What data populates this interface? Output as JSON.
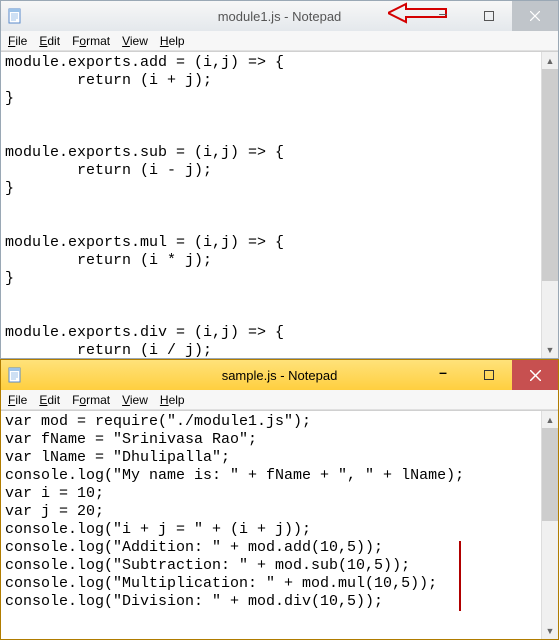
{
  "windows": [
    {
      "title": "module1.js - Notepad",
      "active": false,
      "menu": [
        "File",
        "Edit",
        "Format",
        "View",
        "Help"
      ],
      "menu_ul": [
        "F",
        "E",
        "o",
        "V",
        "H"
      ],
      "content": "module.exports.add = (i,j) => {\n        return (i + j);\n}\n\n\nmodule.exports.sub = (i,j) => {\n        return (i - j);\n}\n\n\nmodule.exports.mul = (i,j) => {\n        return (i * j);\n}\n\n\nmodule.exports.div = (i,j) => {\n        return (i / j);\n}",
      "scrollbar_thumb": {
        "top": 0,
        "height_pct": 78
      }
    },
    {
      "title": "sample.js - Notepad",
      "active": true,
      "menu": [
        "File",
        "Edit",
        "Format",
        "View",
        "Help"
      ],
      "menu_ul": [
        "F",
        "E",
        "o",
        "V",
        "H"
      ],
      "content": "var mod = require(\"./module1.js\");\nvar fName = \"Srinivasa Rao\";\nvar lName = \"Dhulipalla\";\nconsole.log(\"My name is: \" + fName + \", \" + lName);\nvar i = 10;\nvar j = 20;\nconsole.log(\"i + j = \" + (i + j));\nconsole.log(\"Addition: \" + mod.add(10,5));\nconsole.log(\"Subtraction: \" + mod.sub(10,5));\nconsole.log(\"Multiplication: \" + mod.mul(10,5));\nconsole.log(\"Division: \" + mod.div(10,5));",
      "scrollbar_thumb": {
        "top": 0,
        "height_pct": 48
      }
    }
  ],
  "win_controls": {
    "minimize": "–",
    "maximize": "▢",
    "close": "✕"
  },
  "annotation": {
    "color": "#d40000"
  }
}
